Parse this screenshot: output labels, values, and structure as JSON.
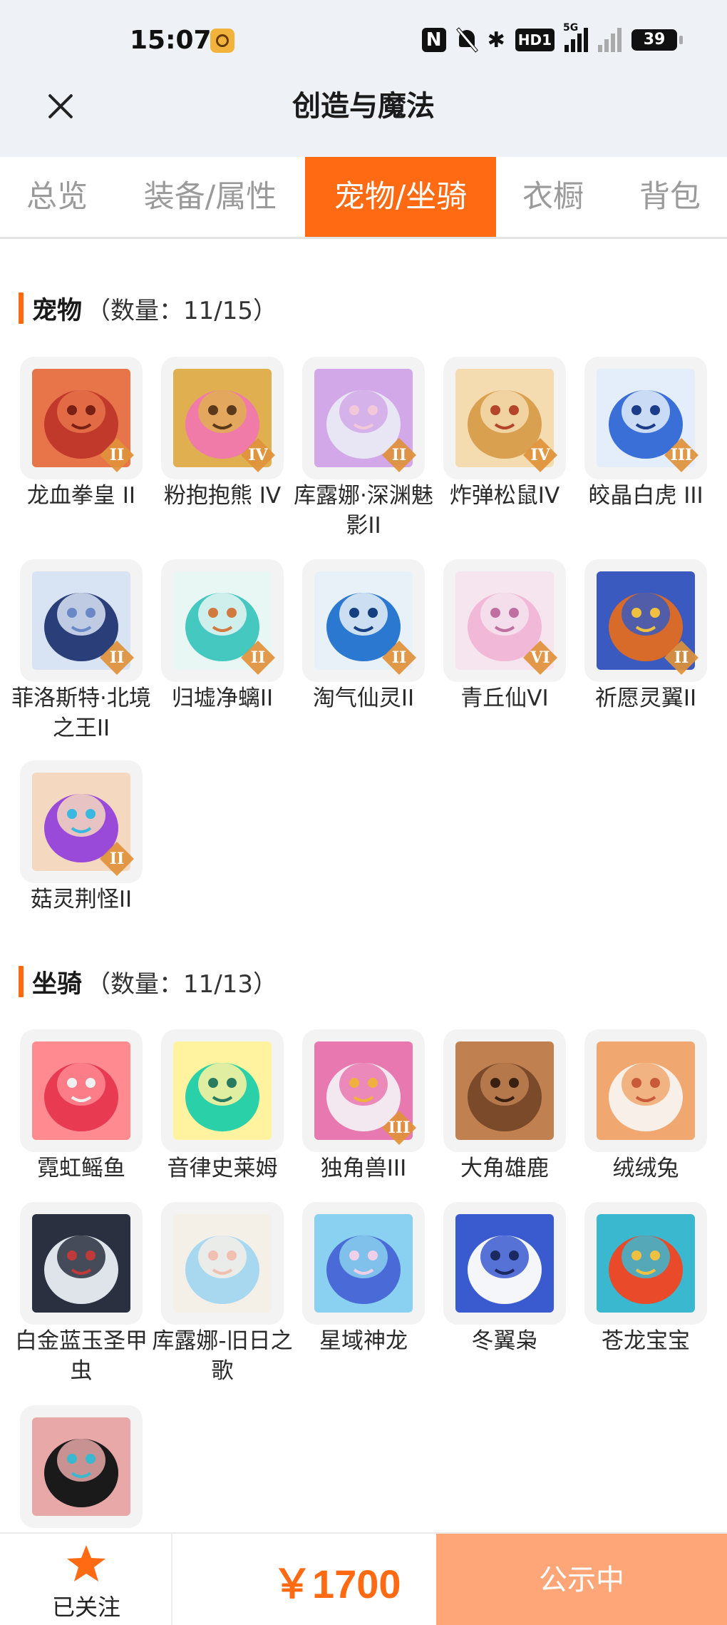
{
  "status_bar": {
    "time": "15:07",
    "nfc": "N",
    "bluetooth": "✱",
    "hd": "HD1",
    "network": "5G",
    "battery": "39"
  },
  "header": {
    "title": "创造与魔法"
  },
  "tabs": [
    {
      "label": "总览",
      "active": false
    },
    {
      "label": "装备/属性",
      "active": false
    },
    {
      "label": "宠物/坐骑",
      "active": true
    },
    {
      "label": "衣橱",
      "active": false
    },
    {
      "label": "背包",
      "active": false
    }
  ],
  "pets": {
    "title": "宠物",
    "count": "（数量：11/15）",
    "items": [
      {
        "name": "龙血拳皇 II",
        "badge": "II",
        "icon": "red-dragon-fighter"
      },
      {
        "name": "粉抱抱熊 IV",
        "badge": "IV",
        "icon": "pink-bear"
      },
      {
        "name": "库露娜·深渊魅影II",
        "badge": "II",
        "icon": "white-hair-girl"
      },
      {
        "name": "炸弹松鼠IV",
        "badge": "IV",
        "icon": "bomb-squirrel"
      },
      {
        "name": "皎晶白虎 III",
        "badge": "III",
        "icon": "white-tiger"
      },
      {
        "name": "菲洛斯特·北境之王II",
        "badge": "II",
        "icon": "frost-king"
      },
      {
        "name": "归墟净螭II",
        "badge": "II",
        "icon": "cyan-dragon"
      },
      {
        "name": "淘气仙灵II",
        "badge": "II",
        "icon": "blue-puppy"
      },
      {
        "name": "青丘仙VI",
        "badge": "VI",
        "icon": "fox-fairy"
      },
      {
        "name": "祈愿灵翼II",
        "badge": "II",
        "icon": "griffin"
      },
      {
        "name": "菇灵荆怪II",
        "badge": "II",
        "icon": "mushroom-sprite"
      }
    ]
  },
  "mounts": {
    "title": "坐骑",
    "count": "（数量：11/13）",
    "items": [
      {
        "name": "霓虹鳐鱼",
        "badge": "",
        "icon": "neon-ray"
      },
      {
        "name": "音律史莱姆",
        "badge": "",
        "icon": "slime"
      },
      {
        "name": "独角兽III",
        "badge": "III",
        "icon": "unicorn"
      },
      {
        "name": "大角雄鹿",
        "badge": "",
        "icon": "stag"
      },
      {
        "name": "绒绒兔",
        "badge": "",
        "icon": "fluffy-rabbit"
      },
      {
        "name": "白金蓝玉圣甲虫",
        "badge": "",
        "icon": "scarab"
      },
      {
        "name": "库露娜-旧日之歌",
        "badge": "",
        "icon": "sheep-girl"
      },
      {
        "name": "星域神龙",
        "badge": "",
        "icon": "star-dragon"
      },
      {
        "name": "冬翼枭",
        "badge": "",
        "icon": "snow-owl"
      },
      {
        "name": "苍龙宝宝",
        "badge": "",
        "icon": "baby-dragon"
      },
      {
        "name": "",
        "badge": "",
        "icon": "black-pig"
      }
    ]
  },
  "bottom": {
    "follow_label": "已关注",
    "price": "￥1700",
    "status_label": "公示中"
  },
  "colors": {
    "accent": "#ff6a13",
    "status_button": "#ffa678",
    "badge": "#e0913a"
  }
}
